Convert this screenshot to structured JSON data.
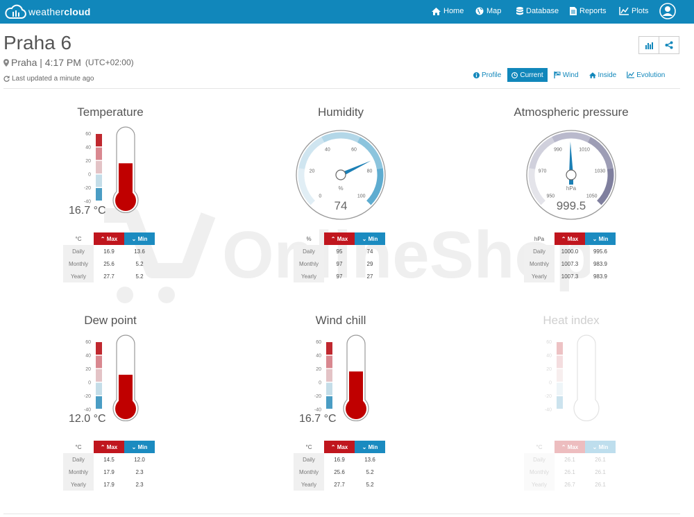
{
  "brand": {
    "name_light": "weather",
    "name_bold": "cloud"
  },
  "nav": {
    "items": [
      {
        "label": "Home",
        "icon": "home-icon"
      },
      {
        "label": "Map",
        "icon": "globe-icon"
      },
      {
        "label": "Database",
        "icon": "database-icon"
      },
      {
        "label": "Reports",
        "icon": "file-icon"
      },
      {
        "label": "Plots",
        "icon": "line-chart-icon"
      }
    ],
    "user_icon": "user-icon"
  },
  "station": {
    "name": "Praha 6",
    "location": "Praha | 4:17 PM",
    "timezone": "(UTC+02:00)",
    "updated": "Last updated a minute ago"
  },
  "tabs": [
    {
      "label": "Profile",
      "icon": "info-icon",
      "active": false
    },
    {
      "label": "Current",
      "icon": "clock-icon",
      "active": true
    },
    {
      "label": "Wind",
      "icon": "flag-icon",
      "active": false
    },
    {
      "label": "Inside",
      "icon": "home-icon",
      "active": false
    },
    {
      "label": "Evolution",
      "icon": "line-chart-icon",
      "active": false
    }
  ],
  "table_headers": {
    "max": "Max",
    "min": "Min",
    "rows": [
      "Daily",
      "Monthly",
      "Yearly"
    ]
  },
  "colors": {
    "brand": "#1187bb",
    "max": "#c0161e",
    "min": "#1b8bc0"
  },
  "temperature": {
    "title": "Temperature",
    "readout": "16.7 °C",
    "value": 16.7,
    "scale_labels": [
      "60",
      "40",
      "20",
      "0",
      "-20",
      "-40"
    ],
    "unit": "°C",
    "rows": [
      {
        "max": "16.9",
        "min": "13.6"
      },
      {
        "max": "25.6",
        "min": "5.2"
      },
      {
        "max": "27.7",
        "min": "5.2"
      }
    ]
  },
  "humidity": {
    "title": "Humidity",
    "value": 74,
    "value_text": "74",
    "unit_label": "%",
    "ticks": [
      "0",
      "20",
      "40",
      "60",
      "80",
      "100"
    ],
    "unit": "%",
    "rows": [
      {
        "max": "95",
        "min": "74"
      },
      {
        "max": "97",
        "min": "29"
      },
      {
        "max": "97",
        "min": "27"
      }
    ]
  },
  "pressure": {
    "title": "Atmospheric pressure",
    "value": 999.5,
    "value_text": "999.5",
    "unit_label": "hPa",
    "ticks": [
      "950",
      "970",
      "990",
      "1010",
      "1030",
      "1050"
    ],
    "unit": "hPa",
    "rows": [
      {
        "max": "1000.0",
        "min": "995.6"
      },
      {
        "max": "1007.3",
        "min": "983.9"
      },
      {
        "max": "1007.3",
        "min": "983.9"
      }
    ]
  },
  "dewpoint": {
    "title": "Dew point",
    "readout": "12.0 °C",
    "value": 12.0,
    "scale_labels": [
      "60",
      "40",
      "20",
      "0",
      "-20",
      "-40"
    ],
    "unit": "°C",
    "rows": [
      {
        "max": "14.5",
        "min": "12.0"
      },
      {
        "max": "17.9",
        "min": "2.3"
      },
      {
        "max": "17.9",
        "min": "2.3"
      }
    ]
  },
  "windchill": {
    "title": "Wind chill",
    "readout": "16.7 °C",
    "value": 16.7,
    "scale_labels": [
      "60",
      "40",
      "20",
      "0",
      "-20",
      "-40"
    ],
    "unit": "°C",
    "rows": [
      {
        "max": "16.9",
        "min": "13.6"
      },
      {
        "max": "25.6",
        "min": "5.2"
      },
      {
        "max": "27.7",
        "min": "5.2"
      }
    ]
  },
  "heatindex": {
    "title": "Heat index",
    "readout": "",
    "value": null,
    "scale_labels": [
      "60",
      "40",
      "20",
      "0",
      "-20",
      "-40"
    ],
    "unit": "°C",
    "rows": [
      {
        "max": "26.1",
        "min": "26.1"
      },
      {
        "max": "26.1",
        "min": "26.1"
      },
      {
        "max": "26.7",
        "min": "26.1"
      }
    ]
  },
  "watermark": "OnlineShop"
}
